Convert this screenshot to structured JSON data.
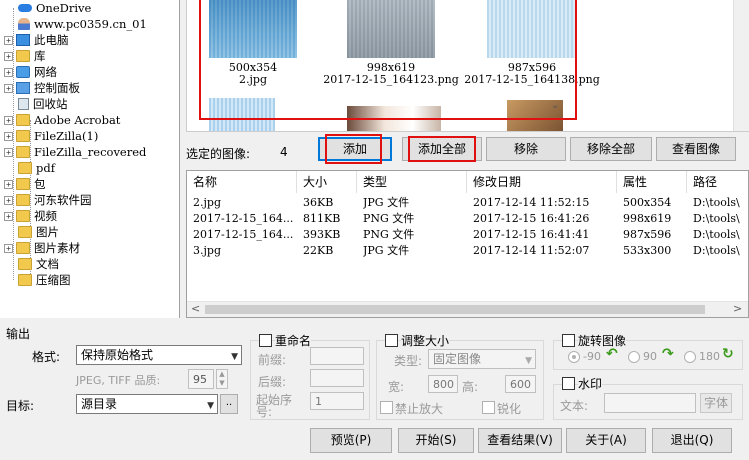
{
  "tree": {
    "items": [
      {
        "label": "OneDrive",
        "icon": "cloud-icon"
      },
      {
        "label": "www.pc0359.cn_01",
        "icon": "user-icon"
      },
      {
        "label": "此电脑",
        "icon": "computer-icon"
      },
      {
        "label": "库",
        "icon": "library-icon"
      },
      {
        "label": "网络",
        "icon": "network-icon"
      },
      {
        "label": "控制面板",
        "icon": "control-panel-icon"
      },
      {
        "label": "回收站",
        "icon": "recycle-bin-icon"
      },
      {
        "label": "Adobe Acrobat",
        "icon": "folder-icon"
      },
      {
        "label": "FileZilla(1)",
        "icon": "folder-icon"
      },
      {
        "label": "FileZilla_recovered",
        "icon": "folder-icon"
      },
      {
        "label": "pdf",
        "icon": "folder-icon"
      },
      {
        "label": "包",
        "icon": "folder-icon"
      },
      {
        "label": "河东软件园",
        "icon": "folder-icon"
      },
      {
        "label": "视频",
        "icon": "folder-icon"
      },
      {
        "label": "图片",
        "icon": "folder-icon"
      },
      {
        "label": "图片素材",
        "icon": "folder-icon"
      },
      {
        "label": "文档",
        "icon": "folder-icon"
      },
      {
        "label": "压缩图",
        "icon": "folder-icon"
      }
    ]
  },
  "thumbs": [
    {
      "size": "500x354",
      "name": "2.jpg"
    },
    {
      "size": "998x619",
      "name": "2017-12-15_164123.png"
    },
    {
      "size": "987x596",
      "name": "2017-12-15_164138.png"
    }
  ],
  "selection": {
    "label": "选定的图像:",
    "count": "4"
  },
  "buttons": {
    "add": "添加",
    "add_all": "添加全部",
    "remove": "移除",
    "remove_all": "移除全部",
    "view": "查看图像"
  },
  "list": {
    "headers": [
      "名称",
      "大小",
      "类型",
      "修改日期",
      "属性",
      "路径"
    ],
    "rows": [
      [
        "2.jpg",
        "36KB",
        "JPG 文件",
        "2017-12-14 11:52:15",
        "500x354",
        "D:\\tools\\"
      ],
      [
        "2017-12-15_164...",
        "811KB",
        "PNG 文件",
        "2017-12-15 16:41:26",
        "998x619",
        "D:\\tools\\"
      ],
      [
        "2017-12-15_164...",
        "393KB",
        "PNG 文件",
        "2017-12-15 16:41:41",
        "987x596",
        "D:\\tools\\"
      ],
      [
        "3.jpg",
        "22KB",
        "JPG 文件",
        "2017-12-14 11:52:07",
        "533x300",
        "D:\\tools\\"
      ]
    ]
  },
  "output": {
    "title": "输出",
    "format_label": "格式:",
    "format_value": "保持原始格式",
    "quality_label": "JPEG, TIFF 品质:",
    "quality_value": "95",
    "target_label": "目标:",
    "target_value": "源目录",
    "browse": ".."
  },
  "rename": {
    "title": "重命名",
    "prefix": "前缀:",
    "suffix": "后缀:",
    "start": "起始序号:",
    "start_value": "1"
  },
  "resize": {
    "title": "调整大小",
    "type_label": "类型:",
    "type_value": "固定图像",
    "width_label": "宽:",
    "width_value": "800",
    "height_label": "高:",
    "height_value": "600",
    "no_enlarge": "禁止放大",
    "sharpen": "锐化"
  },
  "rotate": {
    "title": "旋转图像",
    "opt1": "-90",
    "opt2": "90",
    "opt3": "180"
  },
  "watermark": {
    "title": "水印",
    "text_label": "文本:",
    "font_btn": "字体"
  },
  "footer": {
    "preview": "预览(P)",
    "start": "开始(S)",
    "view_result": "查看结果(V)",
    "about": "关于(A)",
    "exit": "退出(Q)"
  },
  "colors": {
    "highlight": "#e01010",
    "folder": "#f2c94c"
  }
}
